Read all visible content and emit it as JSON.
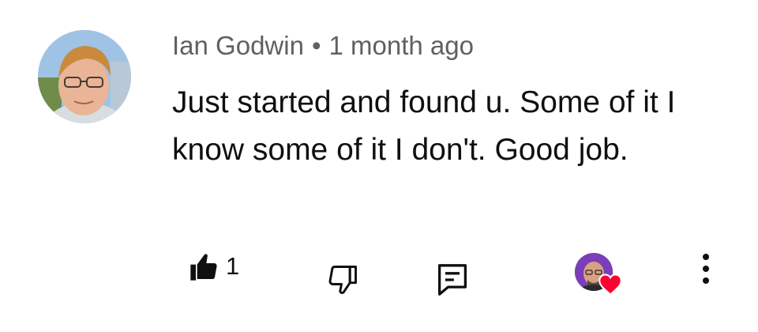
{
  "comment": {
    "author": "Ian Godwin",
    "separator": "•",
    "timestamp": "1 month ago",
    "text": "Just started and found u. Some of it I know some of it I don't. Good job."
  },
  "actions": {
    "like_count": "1",
    "like_icon": "thumbs-up-filled-icon",
    "dislike_icon": "thumbs-down-outline-icon",
    "reply_icon": "reply-comment-icon",
    "creator_heart_icon": "heart-icon",
    "more_icon": "vertical-ellipsis-icon"
  },
  "colors": {
    "text_primary": "#0f0f0f",
    "text_secondary": "#606060",
    "heart": "#ff0033"
  }
}
